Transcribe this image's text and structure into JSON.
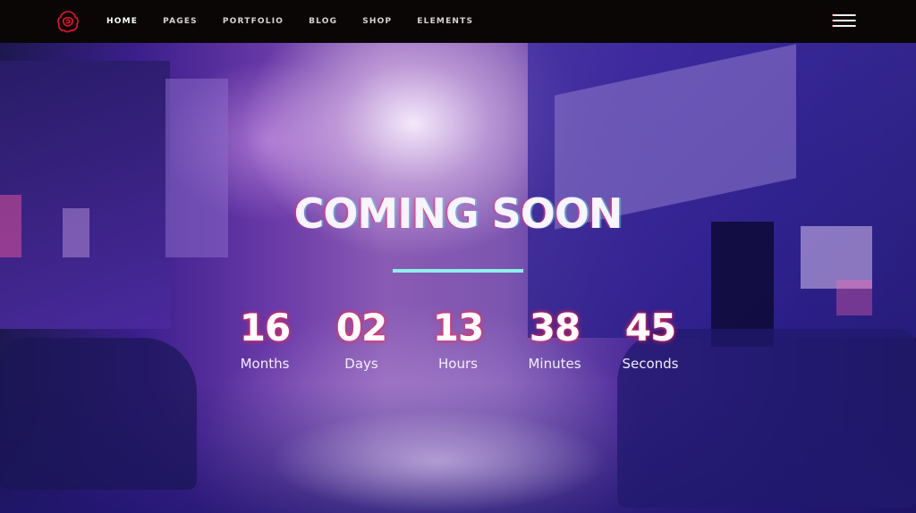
{
  "nav": {
    "items": [
      {
        "label": "HOME",
        "active": true
      },
      {
        "label": "PAGES",
        "active": false
      },
      {
        "label": "PORTFOLIO",
        "active": false
      },
      {
        "label": "BLOG",
        "active": false
      },
      {
        "label": "SHOP",
        "active": false
      },
      {
        "label": "ELEMENTS",
        "active": false
      }
    ],
    "logo_icon": "rose-logo-icon",
    "menu_icon": "hamburger-menu-icon"
  },
  "hero": {
    "title": "COMING SOON",
    "countdown": [
      {
        "value": "16",
        "label": "Months"
      },
      {
        "value": "02",
        "label": "Days"
      },
      {
        "value": "13",
        "label": "Hours"
      },
      {
        "value": "38",
        "label": "Minutes"
      },
      {
        "value": "45",
        "label": "Seconds"
      }
    ]
  },
  "colors": {
    "topbar": "#0a0606",
    "accent_red": "#e8142c",
    "underline": "#8ef0ea",
    "text": "#ffffff"
  }
}
